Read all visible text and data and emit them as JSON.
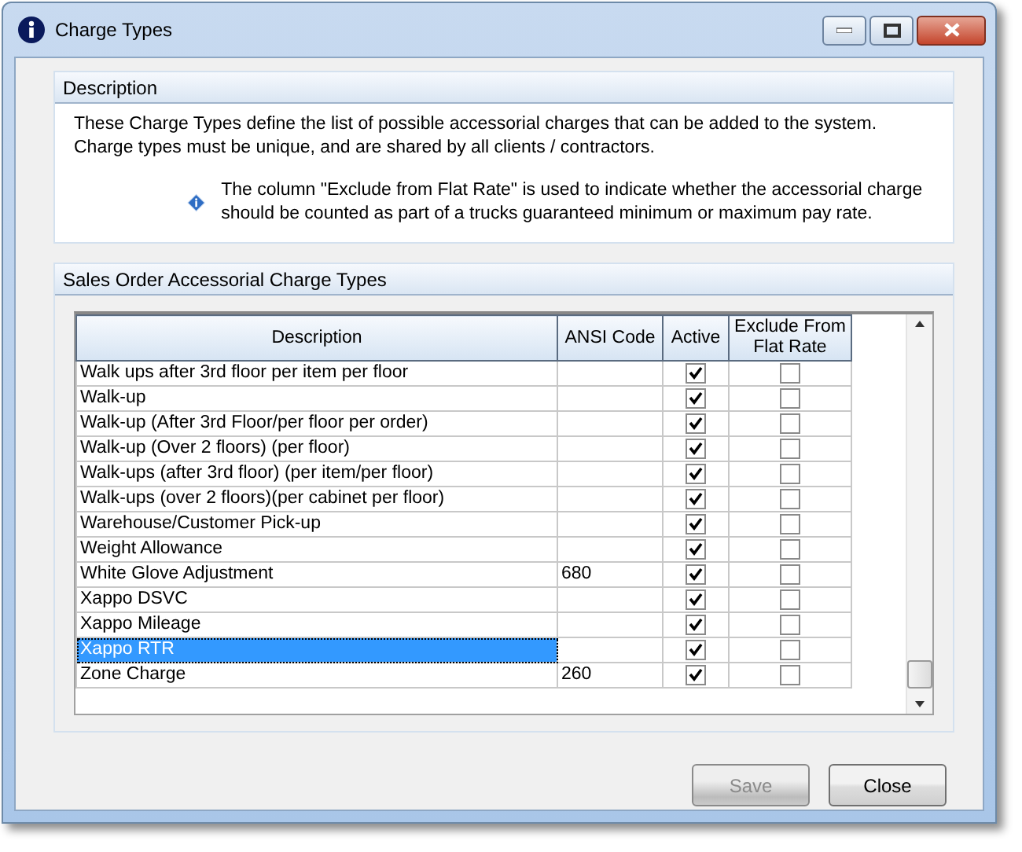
{
  "window": {
    "title": "Charge Types"
  },
  "description": {
    "title": "Description",
    "text": "These Charge Types define the list of possible accessorial charges that can be added to the system.  Charge types must be unique, and are shared by all clients / contractors.",
    "note": "The column \"Exclude from Flat Rate\" is used to indicate whether the accessorial charge should be counted as part of a trucks guaranteed minimum or maximum pay rate."
  },
  "grid": {
    "title": "Sales Order Accessorial Charge Types",
    "columns": [
      "Description",
      "ANSI Code",
      "Active",
      "Exclude From Flat Rate"
    ],
    "rows": [
      {
        "description": "Walk ups after 3rd floor per item per floor",
        "ansi_code": "",
        "active": true,
        "exclude": false,
        "selected": false
      },
      {
        "description": "Walk-up",
        "ansi_code": "",
        "active": true,
        "exclude": false,
        "selected": false
      },
      {
        "description": "Walk-up (After 3rd Floor/per floor per order)",
        "ansi_code": "",
        "active": true,
        "exclude": false,
        "selected": false
      },
      {
        "description": "Walk-up (Over 2 floors) (per floor)",
        "ansi_code": "",
        "active": true,
        "exclude": false,
        "selected": false
      },
      {
        "description": "Walk-ups (after 3rd floor) (per item/per floor)",
        "ansi_code": "",
        "active": true,
        "exclude": false,
        "selected": false
      },
      {
        "description": "Walk-ups (over 2 floors)(per cabinet per floor)",
        "ansi_code": "",
        "active": true,
        "exclude": false,
        "selected": false
      },
      {
        "description": "Warehouse/Customer Pick-up",
        "ansi_code": "",
        "active": true,
        "exclude": false,
        "selected": false
      },
      {
        "description": "Weight Allowance",
        "ansi_code": "",
        "active": true,
        "exclude": false,
        "selected": false
      },
      {
        "description": "White Glove Adjustment",
        "ansi_code": "680",
        "active": true,
        "exclude": false,
        "selected": false
      },
      {
        "description": "Xappo DSVC",
        "ansi_code": "",
        "active": true,
        "exclude": false,
        "selected": false
      },
      {
        "description": "Xappo Mileage",
        "ansi_code": "",
        "active": true,
        "exclude": false,
        "selected": false
      },
      {
        "description": "Xappo RTR",
        "ansi_code": "",
        "active": true,
        "exclude": false,
        "selected": true
      },
      {
        "description": "Zone Charge",
        "ansi_code": "260",
        "active": true,
        "exclude": false,
        "selected": false
      }
    ]
  },
  "buttons": [
    {
      "label": "Save",
      "disabled": true
    },
    {
      "label": "Close",
      "disabled": false
    }
  ]
}
